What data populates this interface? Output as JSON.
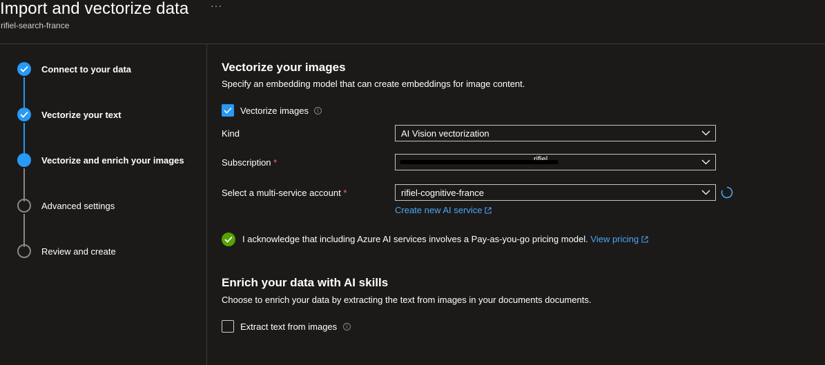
{
  "header": {
    "title": "Import and vectorize data",
    "subtitle": "rifiel-search-france",
    "more": "···"
  },
  "steps": [
    {
      "label": "Connect to your data",
      "status": "done"
    },
    {
      "label": "Vectorize your text",
      "status": "done"
    },
    {
      "label": "Vectorize and enrich your images",
      "status": "current"
    },
    {
      "label": "Advanced settings",
      "status": "todo"
    },
    {
      "label": "Review and create",
      "status": "todo"
    }
  ],
  "vectorize": {
    "heading": "Vectorize your images",
    "description": "Specify an embedding model that can create embeddings for image content.",
    "checkbox_label": "Vectorize images",
    "checkbox_checked": true,
    "kind_label": "Kind",
    "kind_value": "AI Vision vectorization",
    "subscription_label": "Subscription",
    "subscription_value": "rifiel",
    "account_label": "Select a multi-service account",
    "account_value": "rifiel-cognitive-france",
    "create_link": "Create new AI service",
    "required_marker": "*"
  },
  "acknowledge": {
    "text": "I acknowledge that including Azure AI services involves a Pay-as-you-go pricing model.",
    "link": "View pricing"
  },
  "enrich": {
    "heading": "Enrich your data with AI skills",
    "description": "Choose to enrich your data by extracting the text from images in your documents documents.",
    "checkbox_label": "Extract text from images",
    "checkbox_checked": false
  },
  "colors": {
    "accent": "#2899f5",
    "link": "#4ca5f5",
    "success": "#57a300",
    "required": "#f1707b",
    "background": "#1b1a19"
  }
}
